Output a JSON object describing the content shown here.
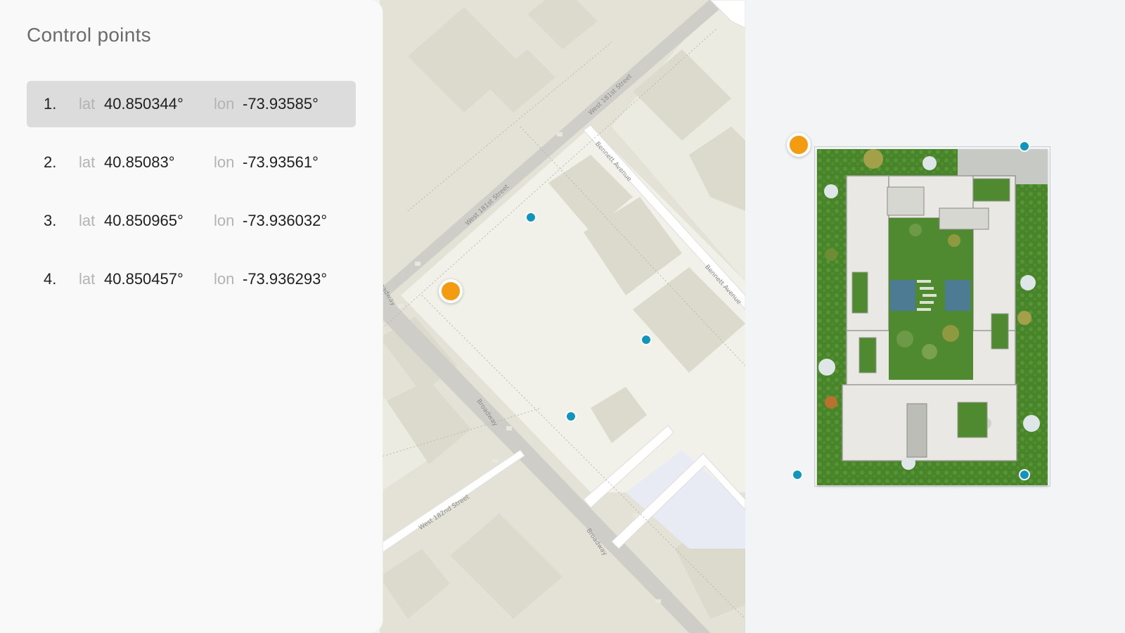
{
  "panel": {
    "title": "Control points",
    "lat_label": "lat",
    "lon_label": "lon",
    "points": [
      {
        "index": "1.",
        "lat": "40.850344°",
        "lon": "-73.93585°",
        "selected": true
      },
      {
        "index": "2.",
        "lat": "40.85083°",
        "lon": "-73.93561°",
        "selected": false
      },
      {
        "index": "3.",
        "lat": "40.850965°",
        "lon": "-73.936032°",
        "selected": false
      },
      {
        "index": "4.",
        "lat": "40.850457°",
        "lon": "-73.936293°",
        "selected": false
      }
    ]
  },
  "map": {
    "streets": {
      "w181_upper": "West 181st Street",
      "w181_lower": "West 181st Street",
      "bennett_upper": "Bennett Avenue",
      "bennett_lower": "Bennett Avenue",
      "broadway_top": "Broadway",
      "broadway_mid": "Broadway",
      "broadway_bottom": "Broadway",
      "w182": "West 182nd Street"
    }
  },
  "colors": {
    "selected_marker": "#f39c12",
    "marker": "#1295bd",
    "selected_row": "#dcdcdc"
  },
  "icons": {
    "selected_point": "orange-circle",
    "other_points": "blue-circle",
    "oneway": "arrow"
  }
}
